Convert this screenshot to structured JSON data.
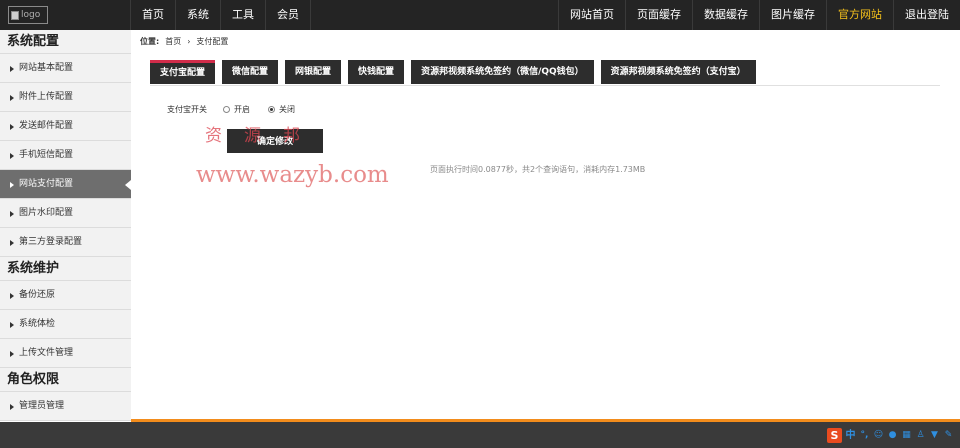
{
  "logo": {
    "alt": "logo"
  },
  "nav_left": [
    "首页",
    "系统",
    "工具",
    "会员"
  ],
  "nav_right": [
    {
      "label": "网站首页",
      "accent": false
    },
    {
      "label": "页面缓存",
      "accent": false
    },
    {
      "label": "数据缓存",
      "accent": false
    },
    {
      "label": "图片缓存",
      "accent": false
    },
    {
      "label": "官方网站",
      "accent": true
    },
    {
      "label": "退出登陆",
      "accent": false
    }
  ],
  "sidebar": {
    "sections": [
      {
        "title": "系统配置",
        "items": [
          "网站基本配置",
          "附件上传配置",
          "发送邮件配置",
          "手机短信配置",
          "网站支付配置",
          "图片水印配置",
          "第三方登录配置"
        ]
      },
      {
        "title": "系统维护",
        "items": [
          "备份还原",
          "系统体检",
          "上传文件管理"
        ]
      },
      {
        "title": "角色权限",
        "items": [
          "管理员管理"
        ]
      }
    ],
    "active_item": "网站支付配置"
  },
  "breadcrumb": {
    "prefix": "位置:",
    "home": "首页",
    "separator": "›",
    "current": "支付配置"
  },
  "tabs": [
    "支付宝配置",
    "微信配置",
    "网银配置",
    "快钱配置",
    "资源邦视频系统免签约（微信/QQ钱包）",
    "资源邦视频系统免签约（支付宝）"
  ],
  "active_tab": "支付宝配置",
  "form": {
    "label": "支付宝开关",
    "option_on": "开启",
    "option_off": "关闭",
    "selected": "关闭",
    "submit_label": "确定修改"
  },
  "exec_info": "页面执行时间0.0877秒，共2个查询语句，消耗内存1.73MB",
  "watermark": {
    "chinese": "资源邦",
    "url": "www.wazyb.com"
  },
  "tray": {
    "logo": "S",
    "lang": "中",
    "icons": [
      "punctuation-icon",
      "emoji-icon",
      "mic-icon",
      "keyboard-icon",
      "user-icon",
      "shirt-icon",
      "wrench-icon"
    ]
  },
  "colors": {
    "topbar": "#242424",
    "accent": "#f6c21b",
    "tab_active_border": "#d12c4a",
    "footer_line": "#f28c1c"
  }
}
